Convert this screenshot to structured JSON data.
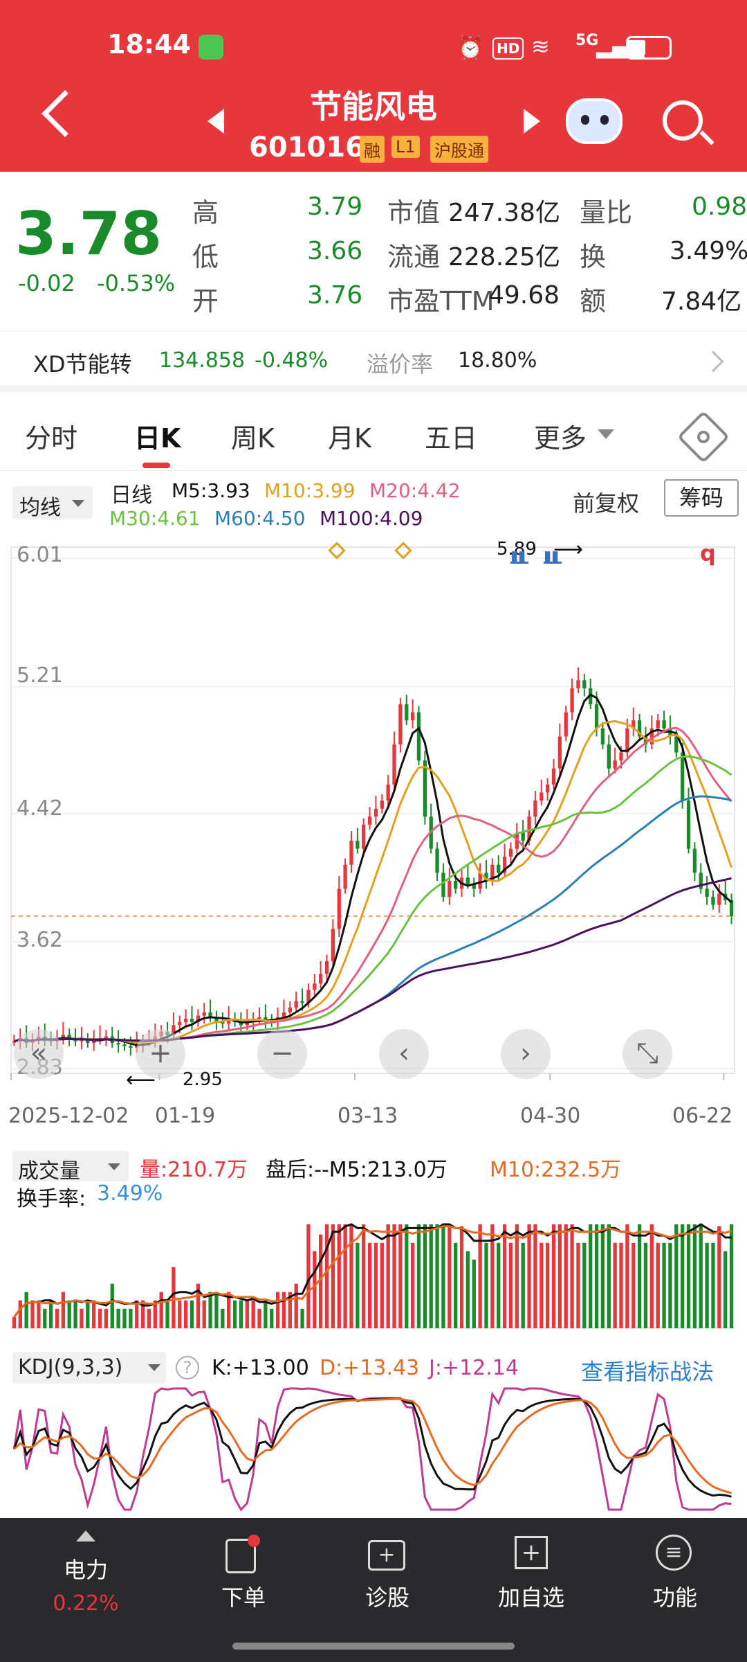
{
  "status_bar": {
    "time": "18:44",
    "network": "5G"
  },
  "header": {
    "title": "节能风电",
    "code": "601016",
    "tags": [
      "融",
      "L1",
      "沪股通"
    ]
  },
  "quote": {
    "price": "3.78",
    "change": "-0.02",
    "change_pct": "-0.53%",
    "rows": [
      {
        "a_label": "高",
        "a_value": "3.79",
        "b_label": "市值",
        "b_value": "247.38亿",
        "c_label": "量比",
        "c_value": "0.98"
      },
      {
        "a_label": "低",
        "a_value": "3.66",
        "b_label": "流通",
        "b_value": "228.25亿",
        "c_label": "换",
        "c_value": "3.49%"
      },
      {
        "a_label": "开",
        "a_value": "3.76",
        "b_label": "市盈TTM",
        "b_value": "49.68",
        "c_label": "额",
        "c_value": "7.84亿"
      }
    ]
  },
  "convertible": {
    "name": "XD节能转",
    "price": "134.858",
    "change_pct": "-0.48%",
    "premium_label": "溢价率",
    "premium": "18.80%"
  },
  "tabs": [
    "分时",
    "日K",
    "周K",
    "月K",
    "五日",
    "更多"
  ],
  "active_tab": "日K",
  "ma_legend": {
    "selector": "均线",
    "period": "日线",
    "m5": "M5:3.93",
    "m10": "M10:3.99",
    "m20": "M20:4.42",
    "m30": "M30:4.61",
    "m60": "M60:4.50",
    "m100": "M100:4.09",
    "adjust": "前复权",
    "chip_button": "筹码"
  },
  "price_axis": [
    "6.01",
    "5.21",
    "4.42",
    "3.62",
    "2.83"
  ],
  "date_axis": [
    "2025-12-02",
    "01-19",
    "03-13",
    "04-30",
    "06-22"
  ],
  "annotations": {
    "high": "5.89",
    "low": "2.95"
  },
  "volume": {
    "selector": "成交量",
    "vol": "量:210.7万",
    "after_hours": "盘后:--M5:213.0万",
    "m10": "M10:232.5万",
    "turnover_label": "换手率:",
    "turnover": "3.49%"
  },
  "kdj": {
    "selector": "KDJ(9,3,3)",
    "k": "K:+13.00",
    "d": "D:+13.43",
    "j": "J:+12.14",
    "link": "查看指标战法"
  },
  "bottom_nav": [
    {
      "label": "电力",
      "sub": "0.22%",
      "icon": "up-triangle-icon"
    },
    {
      "label": "下单",
      "icon": "order-icon"
    },
    {
      "label": "诊股",
      "icon": "diagnose-icon"
    },
    {
      "label": "加自选",
      "icon": "add-watchlist-icon"
    },
    {
      "label": "功能",
      "icon": "menu-icon"
    }
  ],
  "colors": {
    "up": "#e8363d",
    "down": "#1a8a2a",
    "header": "#e8363d",
    "m5": "#111111",
    "m10": "#e0a020",
    "m20": "#e06080",
    "m30": "#6cc040",
    "m60": "#2a7fb8",
    "m100": "#4a1060"
  },
  "chart_data": {
    "type": "candlestick",
    "x_ticks": [
      "2025-12-02",
      "01-19",
      "03-13",
      "04-30",
      "06-22"
    ],
    "y_ticks": [
      6.01,
      5.21,
      4.42,
      3.62,
      2.83
    ],
    "ylim": [
      2.8,
      6.08
    ],
    "close": [
      3.0,
      3.02,
      2.99,
      3.01,
      3.03,
      3.02,
      3.0,
      3.01,
      3.04,
      3.02,
      3.0,
      3.01,
      2.99,
      3.01,
      3.02,
      3.03,
      2.99,
      2.98,
      2.97,
      2.96,
      2.98,
      3.0,
      3.01,
      3.03,
      3.06,
      3.04,
      3.1,
      3.12,
      3.14,
      3.12,
      3.16,
      3.18,
      3.15,
      3.12,
      3.11,
      3.14,
      3.12,
      3.1,
      3.12,
      3.14,
      3.15,
      3.13,
      3.12,
      3.15,
      3.18,
      3.21,
      3.25,
      3.24,
      3.32,
      3.36,
      3.42,
      3.5,
      3.7,
      3.95,
      4.1,
      4.25,
      4.2,
      4.35,
      4.4,
      4.45,
      4.5,
      4.6,
      4.85,
      5.1,
      5.0,
      5.05,
      4.75,
      4.4,
      4.2,
      4.05,
      3.9,
      4.0,
      3.95,
      4.02,
      3.98,
      3.95,
      4.05,
      4.0,
      4.1,
      4.05,
      4.15,
      4.2,
      4.3,
      4.25,
      4.4,
      4.5,
      4.55,
      4.6,
      4.7,
      4.9,
      5.05,
      5.2,
      5.25,
      5.2,
      5.1,
      4.95,
      4.85,
      4.7,
      4.75,
      4.8,
      4.95,
      5.0,
      4.9,
      4.85,
      4.95,
      5.0,
      4.95,
      4.9,
      4.8,
      4.5,
      4.2,
      4.05,
      3.95,
      3.9,
      3.85,
      3.92,
      3.88,
      3.78
    ]
  }
}
